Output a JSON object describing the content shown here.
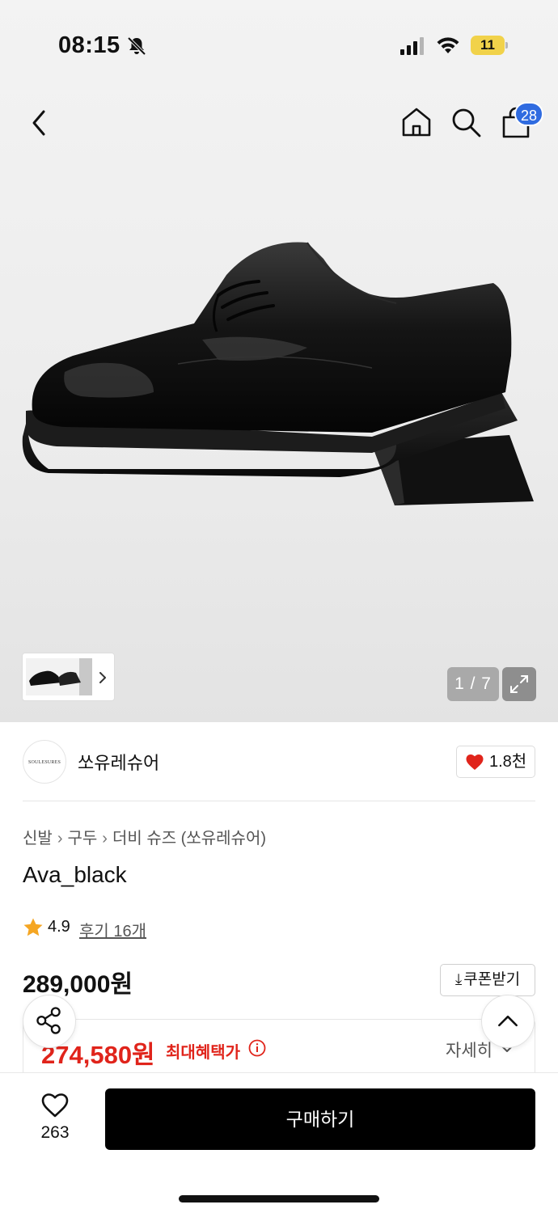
{
  "status_bar": {
    "time": "08:15",
    "battery": "11"
  },
  "header": {
    "cart_count": "28"
  },
  "gallery": {
    "page_counter": "1 / 7"
  },
  "brand": {
    "logo_text": "SOULESURES",
    "name": "쏘유레슈어",
    "like_count": "1.8천"
  },
  "breadcrumb": {
    "level1": "신발",
    "level2": "구두",
    "level3": "더비 슈즈 (쏘유레슈어)"
  },
  "product": {
    "title": "Ava_black",
    "rating": "4.9",
    "reviews": "후기 16개",
    "price": "289,000원",
    "coupon_label": "쿠폰받기",
    "benefit_price": "274,580원",
    "benefit_label": "최대혜택가",
    "detail_label": "자세히"
  },
  "bottom_bar": {
    "wish_count": "263",
    "buy_label": "구매하기"
  },
  "colors": {
    "accent_red": "#e0241b",
    "badge_blue": "#2f6be0",
    "star": "#f5a623"
  }
}
